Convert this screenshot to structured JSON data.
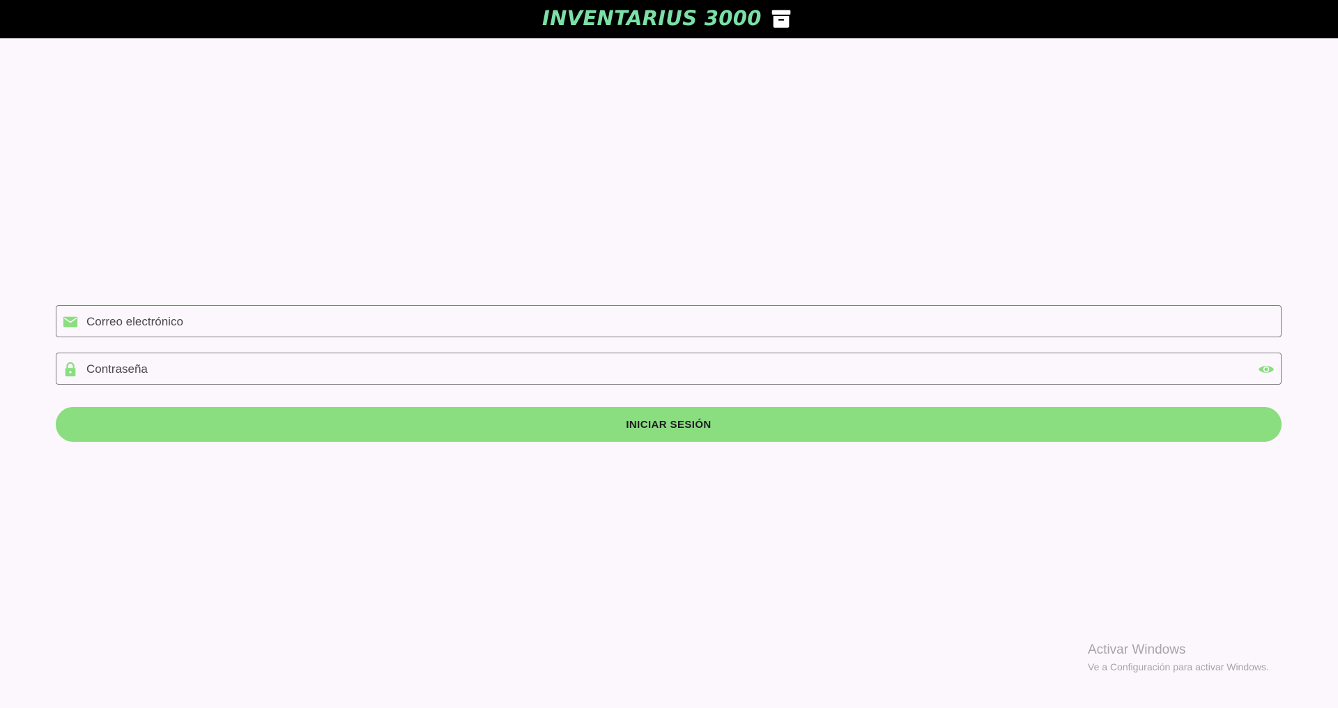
{
  "header": {
    "title": "INVENTARIUS 3000",
    "icon": "archive-box-icon",
    "background": "#000000",
    "title_color": "#7be0a6"
  },
  "login_form": {
    "email": {
      "icon": "mail-icon",
      "label": "Correo electrónico",
      "value": ""
    },
    "password": {
      "icon": "lock-icon",
      "label": "Contraseña",
      "value": "",
      "toggle_icon": "eye-icon"
    },
    "submit_label": "INICIAR SESIÓN",
    "accent_color": "#8ade80"
  },
  "watermark": {
    "title": "Activar Windows",
    "subtitle": "Ve a Configuración para activar Windows."
  }
}
